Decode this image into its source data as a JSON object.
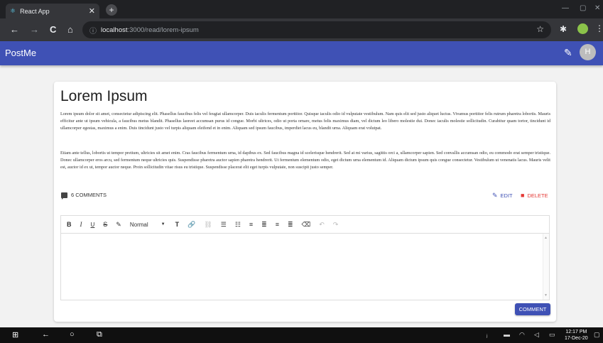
{
  "browser": {
    "tab_title": "React App",
    "tab_close": "✕",
    "new_tab": "+",
    "url_host": "localhost",
    "url_path": ":3000/read/lorem-ipsum",
    "back": "←",
    "forward": "→",
    "reload": "C",
    "home": "⌂",
    "info": "ⓘ",
    "star": "☆",
    "extension": "✱",
    "menu": "⋮",
    "minimize": "—",
    "maximize": "▢",
    "close": "✕"
  },
  "appbar": {
    "title": "PostMe",
    "edit_icon": "✎",
    "avatar_initial": "H"
  },
  "post": {
    "title": "Lorem Ipsum",
    "paragraphs": [
      "Lorem ipsum dolor sit amet, consectetur adipiscing elit. Phasellus faucibus felis vel feugiat ullamcorper. Duis iaculis fermentum porttitor. Quisque iaculis odio id vulputate vestibulum. Nam quis elit sed justo aliquet luctus. Vivamus porttitor felis rutrum pharetra lobortis. Mauris efficitur ante ut ipsum vehicula, a faucibus metus blandit. Phasellus laoreet accumsan purus id congue. Morbi ultrices, odio ut porta ornare, metus felis maximus diam, vel dictum leo libero molestie dui. Donec iaculis molestie sollicitudin. Curabitur quam tortor, tincidunt id ullamcorper egestas, maximus a enim. Duis tincidunt justo vel turpis aliquam eleifend et in enim. Aliquam sed ipsum faucibus, imperdiet lacus eu, blandit urna. Aliquam erat volutpat.",
      "Etiam ante tellus, lobortis ut tempor pretium, ultricies sit amet enim. Cras faucibus fermentum urna, id dapibus ex. Sed faucibus magna id scelerisque hendrerit. Sed at mi varius, sagittis orci a, ullamcorper sapien. Sed convallis accumsan odio, eu commodo erat semper tristique. Donec ullamcorper eros arcu, sed fermentum neque ultricies quis. Suspendisse pharetra auctor sapien pharetra hendrerit. Ut fermentum elementum odio, eget dictum urna elementum id. Aliquam dictum ipsum quis congue consectetur. Vestibulum ut venenatis lacus. Mauris velit est, auctor id ex ut, tempor auctor neque. Proin sollicitudin vitae risus eu tristique. Suspendisse placerat elit eget turpis vulputate, non suscipit justo semper."
    ],
    "comments_label": "6 COMMENTS",
    "edit_label": "EDIT",
    "delete_label": "DELETE"
  },
  "editor": {
    "toolbar": {
      "bold": "B",
      "italic": "I",
      "underline": "U",
      "strike": "S",
      "color": "✎",
      "block_format": "Normal",
      "block_caret": "▼",
      "font_size": "T",
      "link": "🔗",
      "unlink": "⛓",
      "ordered_list": "☰",
      "bullet_list": "☷",
      "align_left": "≡",
      "align_center": "≣",
      "align_right": "≡",
      "align_justify": "≣",
      "clear": "⌫",
      "undo": "↶",
      "redo": "↷"
    },
    "content": "",
    "submit_label": "COMMENT"
  },
  "taskbar": {
    "start": "⊞",
    "back": "←",
    "search": "○",
    "task_view": "⧉",
    "time": "12:17 PM",
    "date": "17-Dec-20"
  },
  "colors": {
    "primary": "#3f51b5",
    "danger": "#e53935"
  }
}
